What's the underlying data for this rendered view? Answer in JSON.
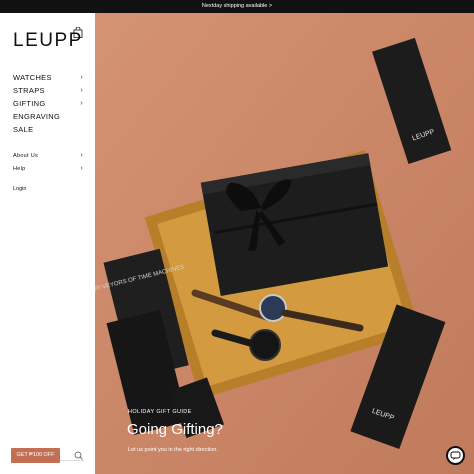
{
  "announcement": {
    "text": "Nextday shipping available >"
  },
  "brand": {
    "logo": "LEUPP"
  },
  "cart": {
    "count": "0"
  },
  "nav": {
    "main": [
      {
        "label": "WATCHES",
        "has_children": true
      },
      {
        "label": "STRAPS",
        "has_children": true
      },
      {
        "label": "GIFTING",
        "has_children": true
      },
      {
        "label": "ENGRAVING",
        "has_children": false
      },
      {
        "label": "SALE",
        "has_children": false
      }
    ],
    "secondary": [
      {
        "label": "About Us",
        "has_children": true
      },
      {
        "label": "Help",
        "has_children": true
      }
    ],
    "login": "Login"
  },
  "hero": {
    "eyebrow": "HOLIDAY GIFT GUIDE",
    "headline": "Going Gifting?",
    "subtext": "Let us point you in the right direction.",
    "box_brand": "LEUPP",
    "card_text": "PUR VEYORS OF TIME MACHINES"
  },
  "carousel": {
    "slides": 3,
    "active_index": 1
  },
  "promo": {
    "label": "GET ₱100 OFF"
  },
  "colors": {
    "hero_bg": "#cf8a68",
    "promo_bg": "#c26f53",
    "announcement_bg": "#111111",
    "tray": "#c8902f",
    "box": "#1b1b1b"
  }
}
